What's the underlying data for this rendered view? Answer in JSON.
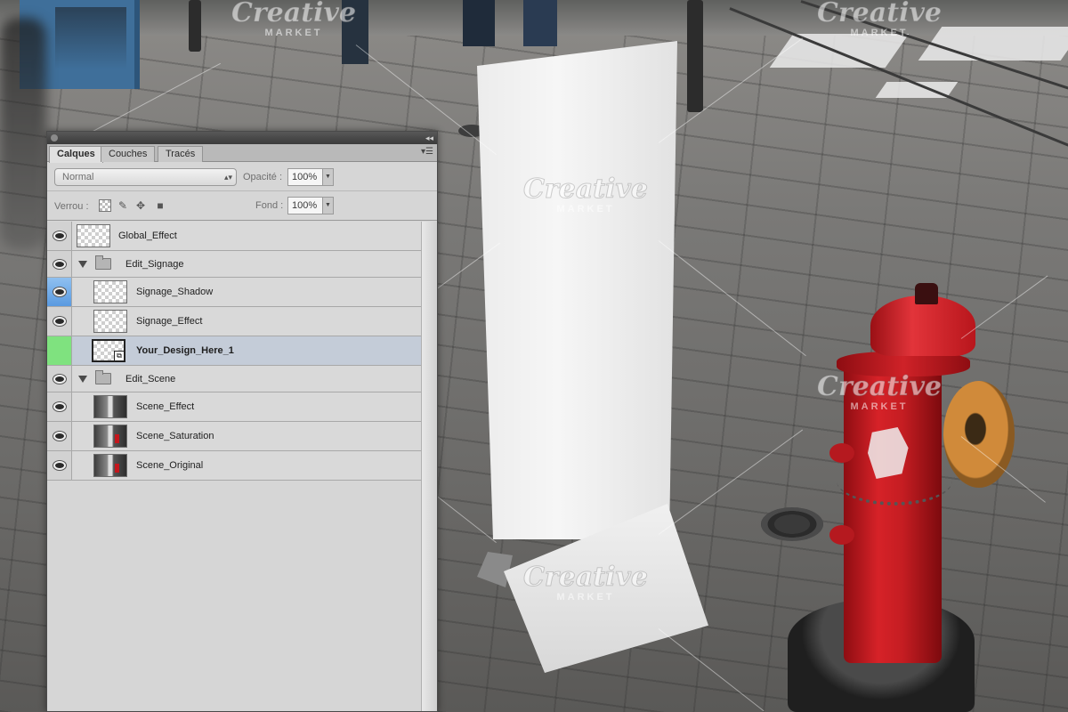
{
  "panel": {
    "tabs": [
      "Calques",
      "Couches",
      "Tracés"
    ],
    "blend_mode": "Normal",
    "opacity_label": "Opacité :",
    "opacity_value": "100%",
    "lock_label": "Verrou :",
    "fill_label": "Fond :",
    "fill_value": "100%",
    "layers": [
      {
        "name": "Global_Effect",
        "type": "layer",
        "indent": 0,
        "visible": true
      },
      {
        "name": "Edit_Signage",
        "type": "group",
        "indent": 0,
        "visible": true
      },
      {
        "name": "Signage_Shadow",
        "type": "layer",
        "indent": 1,
        "visible": true
      },
      {
        "name": "Signage_Effect",
        "type": "layer",
        "indent": 1,
        "visible": true
      },
      {
        "name": "Your_Design_Here_1",
        "type": "smart-object",
        "indent": 1,
        "visible": false,
        "selected": true
      },
      {
        "name": "Edit_Scene",
        "type": "group",
        "indent": 0,
        "visible": true
      },
      {
        "name": "Scene_Effect",
        "type": "layer",
        "indent": 1,
        "visible": true
      },
      {
        "name": "Scene_Saturation",
        "type": "layer",
        "indent": 1,
        "visible": true
      },
      {
        "name": "Scene_Original",
        "type": "layer",
        "indent": 1,
        "visible": true
      }
    ]
  },
  "watermark": {
    "main": "Creative",
    "sub": "MARKET"
  },
  "colors": {
    "hydrant_red": "#d62228",
    "selected_row": "#c4ccd8",
    "eye_blue": "#5a9ae0",
    "eye_green": "#7fe27f"
  }
}
